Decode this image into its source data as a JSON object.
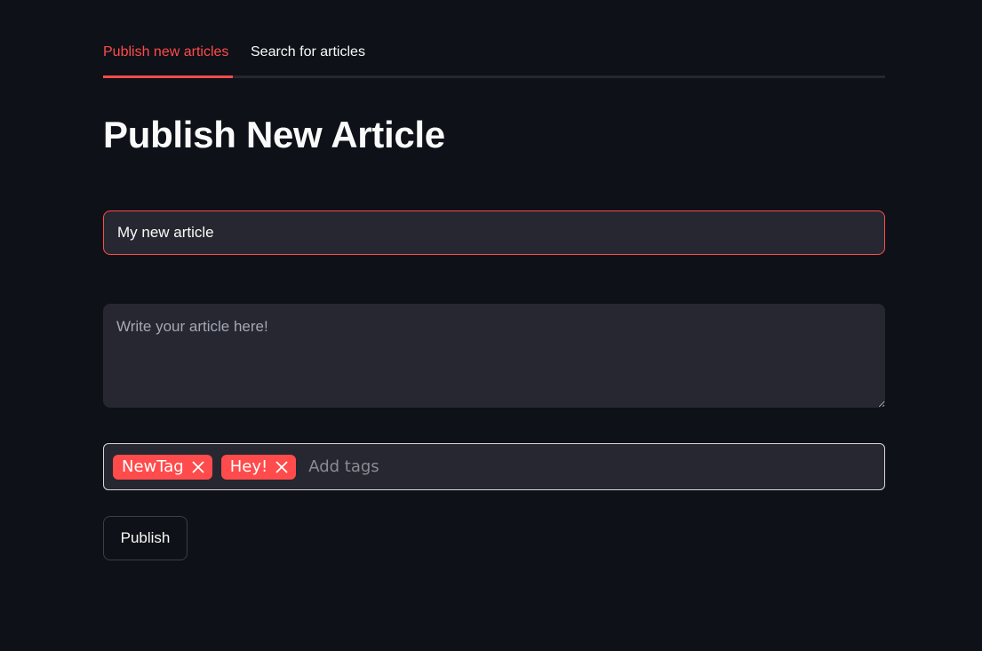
{
  "tabs": [
    {
      "label": "Publish new articles",
      "active": true
    },
    {
      "label": "Search for articles",
      "active": false
    }
  ],
  "page": {
    "title": "Publish New Article"
  },
  "form": {
    "title_value": "My new article",
    "content_value": "",
    "content_placeholder": "Write your article here!",
    "tags": [
      "NewTag",
      "Hey!"
    ],
    "tags_placeholder": "Add tags",
    "publish_label": "Publish"
  },
  "colors": {
    "background": "#0e1117",
    "accent": "#ff4b4b",
    "input_bg": "#262730",
    "text": "#fafafa"
  },
  "icons": {
    "tag_remove": "close-icon"
  }
}
